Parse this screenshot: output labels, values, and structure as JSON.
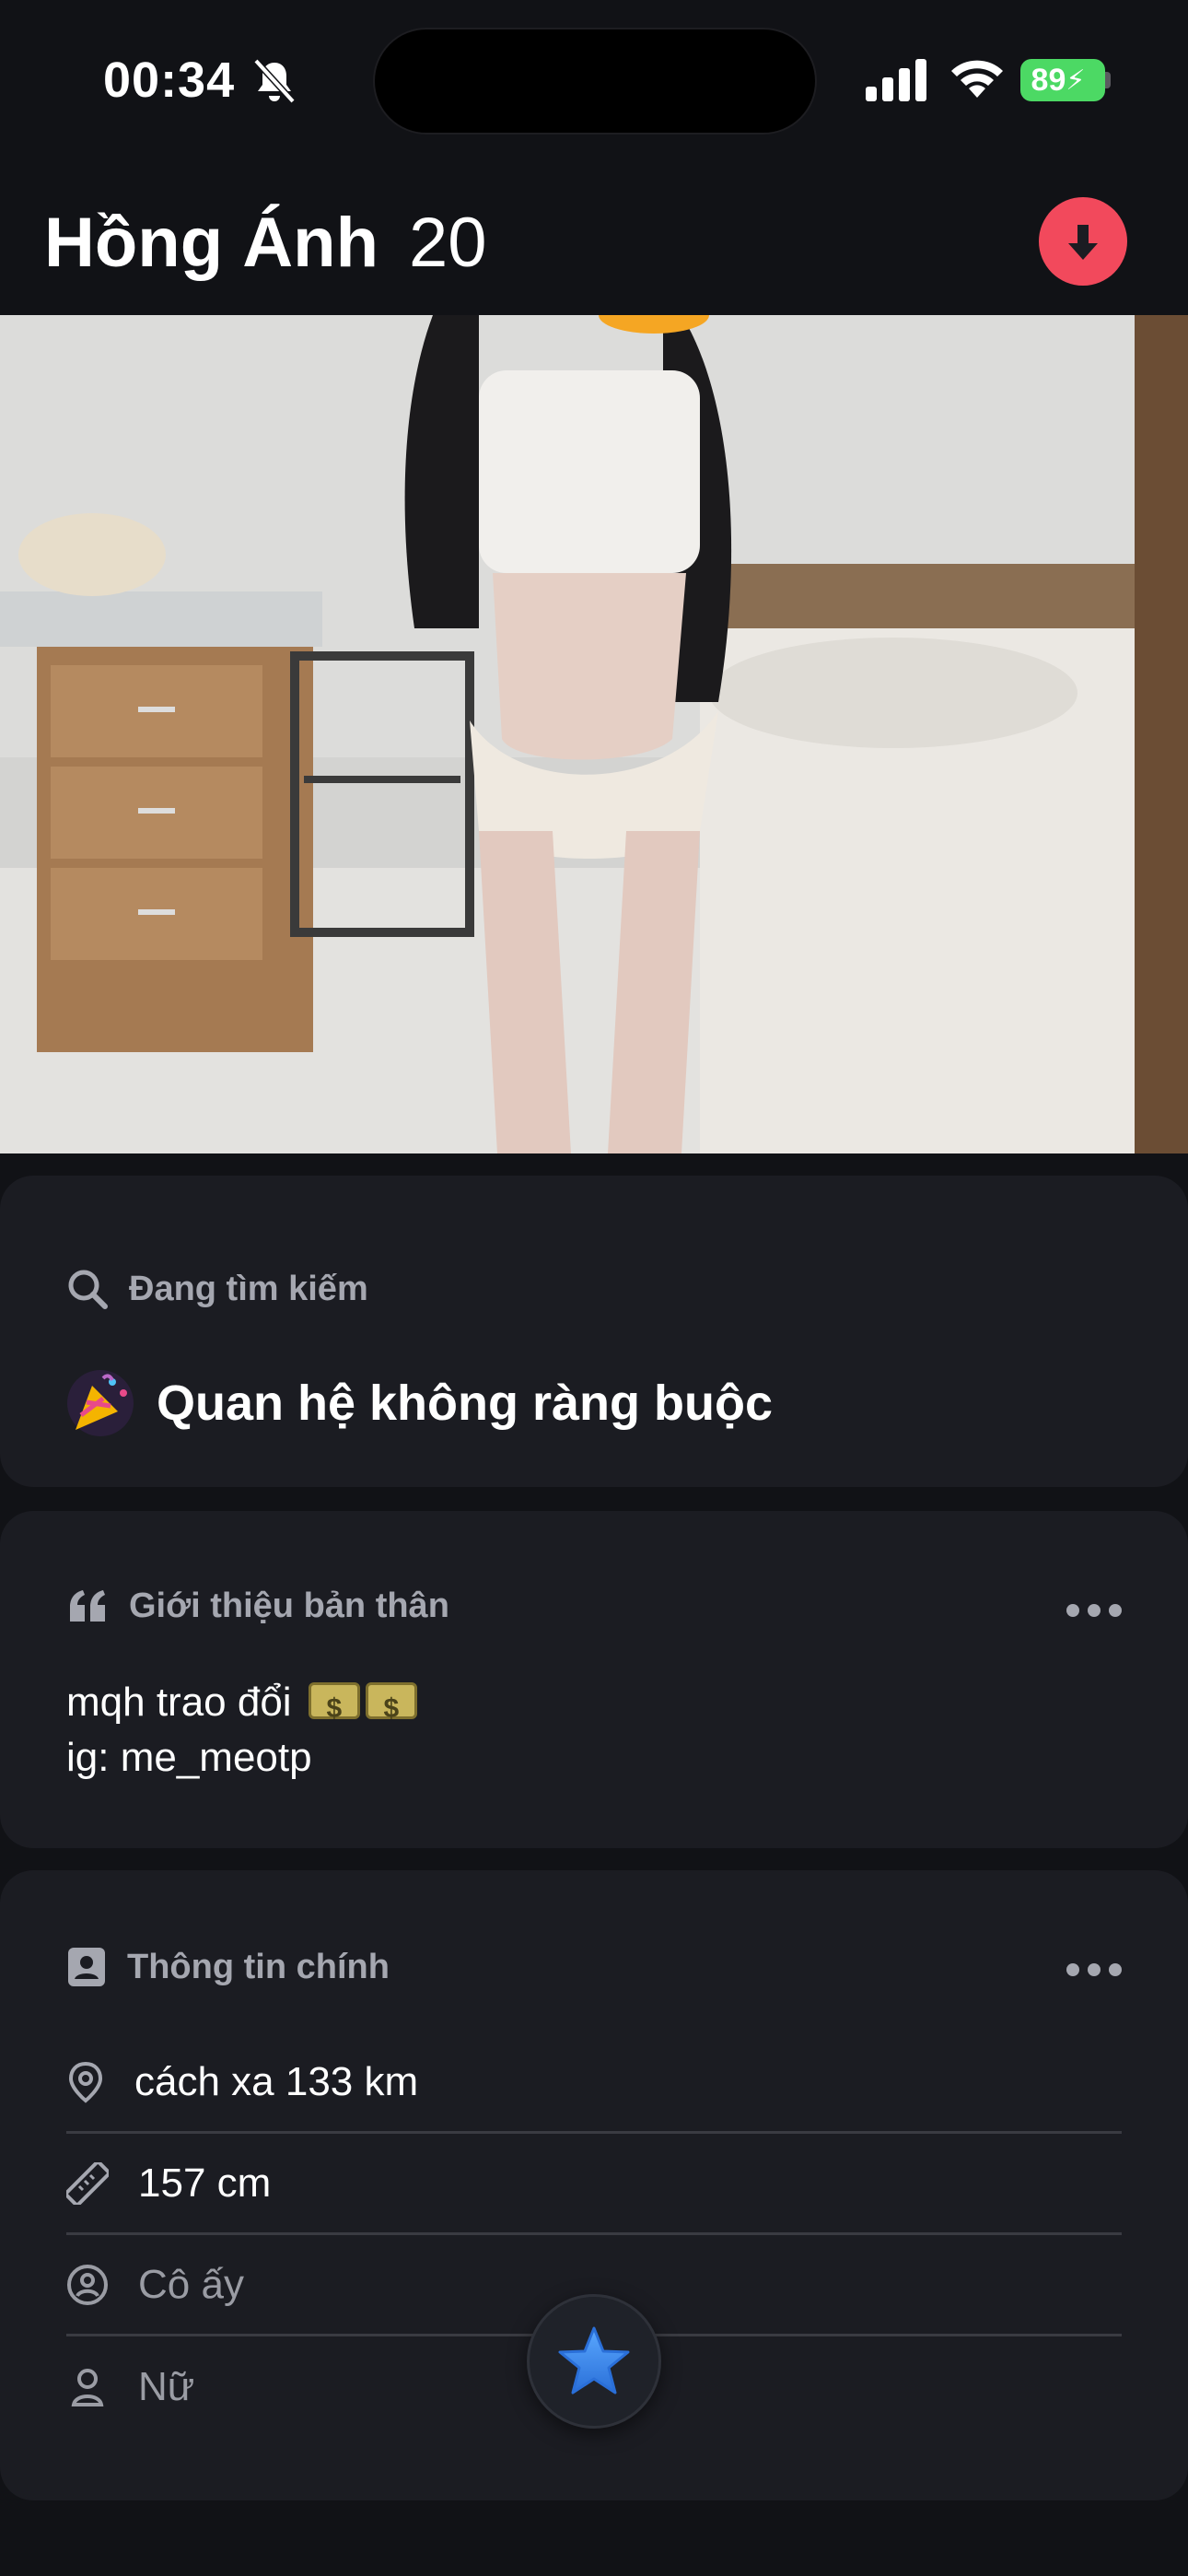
{
  "status_bar": {
    "time": "00:34",
    "battery": "89"
  },
  "profile": {
    "name": "Hồng Ánh",
    "age": "20"
  },
  "looking_for": {
    "heading": "Đang tìm kiếm",
    "value": "Quan hệ không ràng buộc"
  },
  "bio": {
    "heading": "Giới thiệu bản thân",
    "line1": "mqh trao đổi",
    "line2": "ig: me_meotp"
  },
  "basics": {
    "heading": "Thông tin chính",
    "distance": "cách xa 133 km",
    "height": "157 cm",
    "pronoun": "Cô ấy",
    "gender": "Nữ"
  },
  "colors": {
    "accent": "#f2495c",
    "background": "#111216",
    "card": "#1b1c22",
    "star": "#3d8bf2"
  }
}
